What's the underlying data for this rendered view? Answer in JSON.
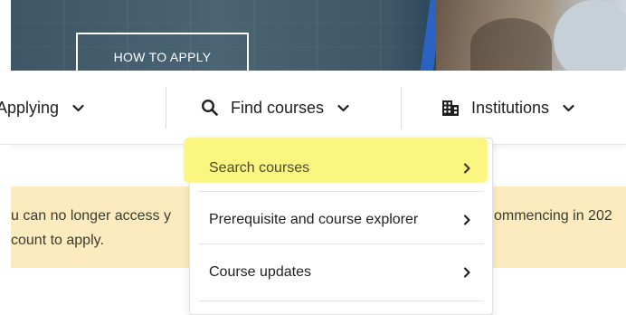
{
  "hero": {
    "cta_label": "HOW TO APPLY"
  },
  "nav": {
    "items": [
      {
        "label": "Applying",
        "icon": "chevron-down-icon"
      },
      {
        "label": "Find courses",
        "icon": "search-icon"
      },
      {
        "label": "Institutions",
        "icon": "building-icon"
      }
    ]
  },
  "dropdown": {
    "items": [
      {
        "label": "Search courses",
        "highlighted": true
      },
      {
        "label": "Prerequisite and course explorer",
        "highlighted": false
      },
      {
        "label": "Course updates",
        "highlighted": false
      }
    ]
  },
  "alert": {
    "line1": "u can no longer access y",
    "line1_right": "ommencing in 202",
    "line2": "count to apply."
  },
  "colors": {
    "highlight": "#fbf680",
    "alert_bg": "#fbebbe",
    "accent_stripe": "#2b63c4",
    "hero_bg": "#3d5666"
  }
}
